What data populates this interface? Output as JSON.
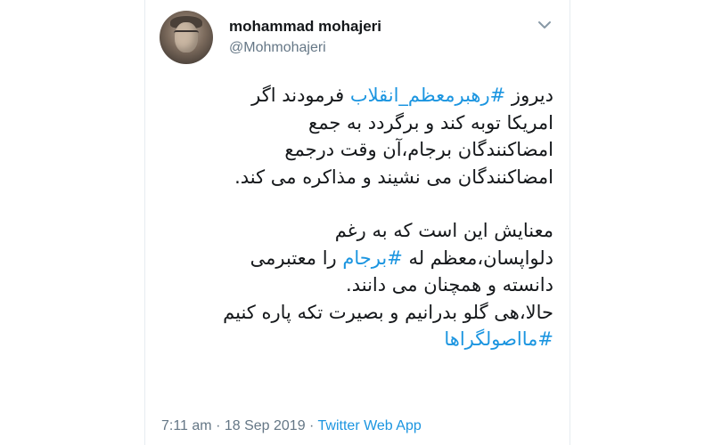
{
  "author": {
    "name": "mohammad mohajeri",
    "handle": "@Mohmohajeri"
  },
  "tweet": {
    "line1_a": "دیروز ",
    "hashtag1": "#رهبرمعظم_انقلاب",
    "line1_b": " فرمودند اگر",
    "line2": "امریکا توبه کند و برگردد به جمع",
    "line3": "امضاکنندگان برجام،آن وقت درجمع",
    "line4": "امضاکنندگان می نشیند و مذاکره می کند.",
    "line5": "معنایش این است که به رغم",
    "line6_a": "دلواپسان،معظم له ",
    "hashtag2": "#برجام",
    "line6_b": " را معتبرمی",
    "line7": "دانسته و همچنان می دانند.",
    "line8": "حالا،هی گلو بدرانیم و بصیرت تکه پاره کنیم",
    "hashtag3": "#مااصولگراها"
  },
  "meta": {
    "time": "7:11 am",
    "separator": " · ",
    "date": "18 Sep 2019",
    "source": "Twitter Web App"
  },
  "colors": {
    "link": "#1b95e0",
    "text": "#14171a",
    "secondary": "#657786"
  },
  "icons": {
    "menu": "chevron-down-icon"
  }
}
